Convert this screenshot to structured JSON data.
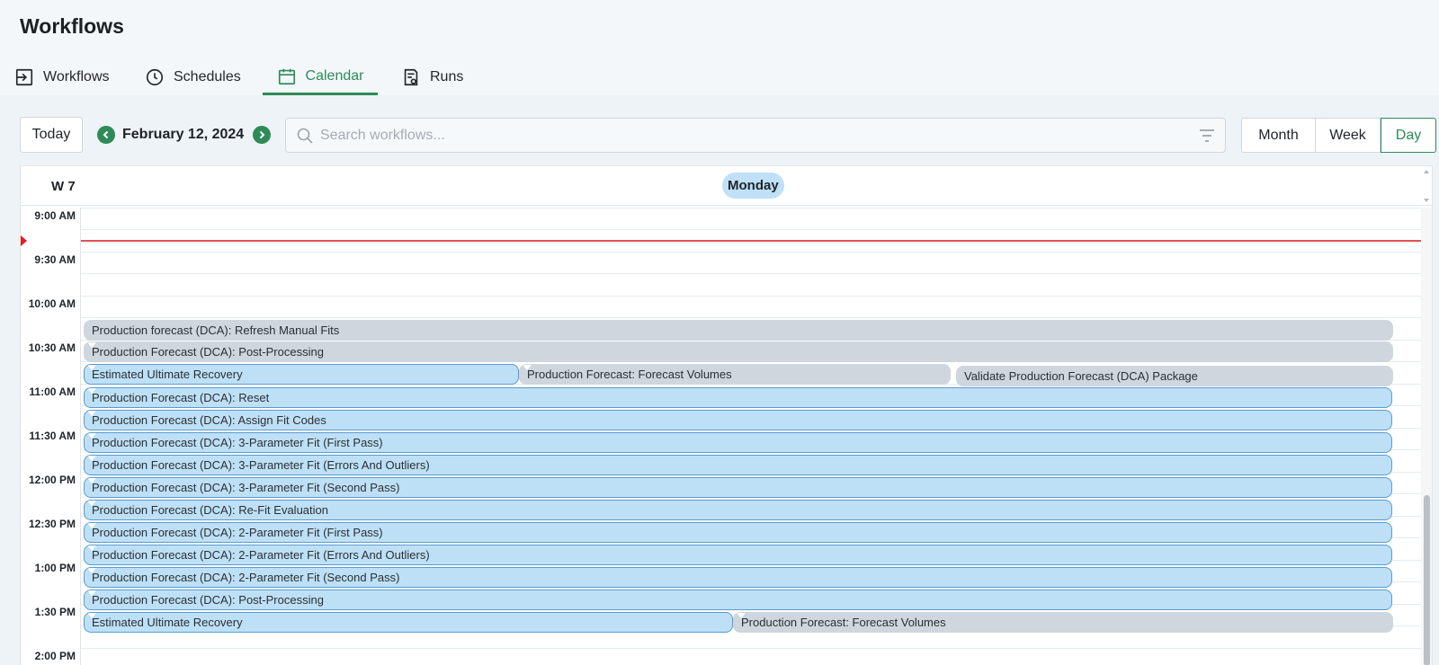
{
  "header": {
    "title": "Workflows",
    "tabs": [
      {
        "label": "Workflows",
        "icon": "import-icon"
      },
      {
        "label": "Schedules",
        "icon": "clock-icon"
      },
      {
        "label": "Calendar",
        "icon": "calendar-icon",
        "active": true
      },
      {
        "label": "Runs",
        "icon": "runs-icon"
      }
    ]
  },
  "toolbar": {
    "today_label": "Today",
    "date_label": "February 12, 2024",
    "search_placeholder": "Search workflows...",
    "view_buttons": [
      "Month",
      "Week",
      "Day"
    ],
    "active_view": "Day"
  },
  "calendar": {
    "week_label": "W 7",
    "day_label": "Monday",
    "time_labels": [
      "9:00 AM",
      "9:30 AM",
      "10:00 AM",
      "10:30 AM",
      "11:00 AM",
      "11:30 AM",
      "12:00 PM",
      "12:30 PM",
      "1:00 PM",
      "1:30 PM",
      "2:00 PM"
    ],
    "events": [
      {
        "label": "Production forecast (DCA): Refresh Manual Fits",
        "style": "gray"
      },
      {
        "label": "Production Forecast (DCA): Post-Processing",
        "style": "gray"
      },
      {
        "label": "Estimated Ultimate Recovery",
        "style": "blue"
      },
      {
        "label": "Production Forecast: Forecast Volumes",
        "style": "gray"
      },
      {
        "label": "Validate Production Forecast (DCA) Package",
        "style": "gray"
      },
      {
        "label": "Production Forecast (DCA): Reset",
        "style": "blue"
      },
      {
        "label": "Production Forecast (DCA): Assign Fit Codes",
        "style": "blue"
      },
      {
        "label": "Production Forecast (DCA): 3-Parameter Fit (First Pass)",
        "style": "blue"
      },
      {
        "label": "Production Forecast (DCA): 3-Parameter Fit (Errors And Outliers)",
        "style": "blue"
      },
      {
        "label": "Production Forecast (DCA): 3-Parameter Fit (Second Pass)",
        "style": "blue"
      },
      {
        "label": "Production Forecast (DCA): Re-Fit Evaluation",
        "style": "blue"
      },
      {
        "label": "Production Forecast (DCA): 2-Parameter Fit (First Pass)",
        "style": "blue"
      },
      {
        "label": "Production Forecast (DCA): 2-Parameter Fit (Errors And Outliers)",
        "style": "blue"
      },
      {
        "label": "Production Forecast (DCA): 2-Parameter Fit (Second Pass)",
        "style": "blue"
      },
      {
        "label": "Production Forecast (DCA): Post-Processing",
        "style": "blue"
      },
      {
        "label": "Estimated Ultimate Recovery",
        "style": "blue"
      },
      {
        "label": "Production Forecast: Forecast Volumes",
        "style": "gray"
      }
    ]
  },
  "colors": {
    "accent": "#2e8b57",
    "event_blue": "#bee0f6",
    "event_gray": "#cfd6de",
    "now_line": "#e05252"
  }
}
